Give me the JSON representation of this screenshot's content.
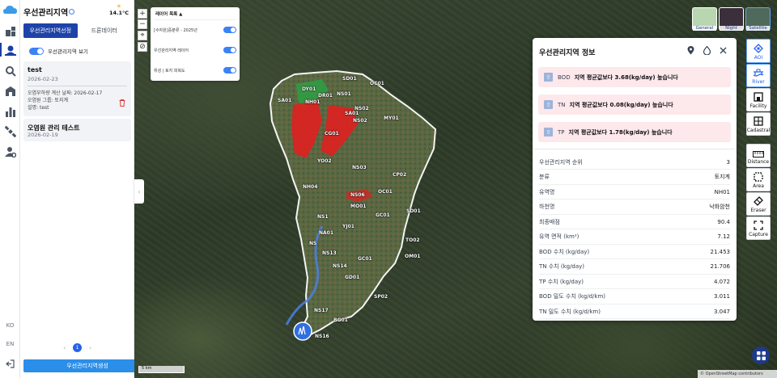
{
  "app": {
    "title": "우선관리지역",
    "weather_temp": "14.1°C"
  },
  "panel": {
    "tabs": [
      "우선관리지역선정",
      "드론데이터"
    ],
    "show_toggle_label": "우선관리지역 보기",
    "items": [
      {
        "title": "test",
        "date": "2026-02-23",
        "calc_date_label": "오염부하량 계산 날짜: 2026-02-17",
        "group_label": "오염원 그룹: 토지계",
        "desc_label": "설명: test"
      },
      {
        "title": "오염원 관리 테스트",
        "date": "2026-02-19"
      }
    ],
    "page": "1",
    "create_button": "우선관리지역생성"
  },
  "rail": {
    "icons": [
      "map-layers-icon",
      "user-location-icon",
      "analysis-icon",
      "building-icon",
      "bar-chart-icon",
      "satellite-icon",
      "user-settings-icon"
    ],
    "lang_ko": "KO",
    "lang_en": "EN"
  },
  "layers_panel": {
    "header": "레이어 목록 ▲",
    "rows": [
      {
        "label": "[수자원]중분류 - 2025년"
      },
      {
        "label": "우선관리지역 레이어"
      },
      {
        "label": "위성 | 토지 피복도"
      }
    ]
  },
  "map_labels": [
    "SD01",
    "DY01",
    "SA01",
    "NH01",
    "DR01",
    "NS01",
    "NS02",
    "SA01",
    "CG01",
    "MY01",
    "OC01",
    "YO02",
    "NS03",
    "NS02",
    "CP02",
    "NH04",
    "NS06",
    "OC01",
    "MO01",
    "GC01",
    "NS1",
    "YJ01",
    "NA01",
    "NS",
    "GC01",
    "NS13",
    "NS14",
    "GD01",
    "BG01",
    "NS17",
    "NS16",
    "SP02",
    "TO02",
    "OM01",
    "SD01"
  ],
  "basemaps": [
    {
      "label": "General",
      "color": "#b8d7b0"
    },
    {
      "label": "Night",
      "color": "#3a2f3a"
    },
    {
      "label": "Satellite",
      "color": "#4f6a5a"
    }
  ],
  "info": {
    "title": "우선관리지역 정보",
    "alerts": [
      {
        "key": "BOD",
        "message": "지역 평균값보다 3.68(kg/day) 높습니다"
      },
      {
        "key": "TN",
        "message": "지역 평균값보다 0.08(kg/day) 높습니다"
      },
      {
        "key": "TP",
        "message": "지역 평균값보다 1.78(kg/day) 높습니다"
      }
    ],
    "rows": [
      {
        "label": "우선관리지역 순위",
        "value": "3"
      },
      {
        "label": "분류",
        "value": "토지계"
      },
      {
        "label": "유역명",
        "value": "NH01"
      },
      {
        "label": "하천명",
        "value": "낙화암천"
      },
      {
        "label": "최종배점",
        "value": "90.4"
      },
      {
        "label": "유역 면적 (km²)",
        "value": "7.12"
      },
      {
        "label": "BOD 수치 (kg/day)",
        "value": "21.453"
      },
      {
        "label": "TN 수치 (kg/day)",
        "value": "21.706"
      },
      {
        "label": "TP 수치 (kg/day)",
        "value": "4.072"
      },
      {
        "label": "BOD 밀도 수치 (kg/d/km)",
        "value": "3.011"
      },
      {
        "label": "TN 밀도 수치 (kg/d/km)",
        "value": "3.047"
      }
    ]
  },
  "toolbar": {
    "aoi": "AOI",
    "river": "River",
    "facility": "Facility",
    "cadastral": "Cadastral",
    "distance": "Distance",
    "area": "Area",
    "eraser": "Eraser",
    "capture": "Capture"
  },
  "scale_label": "5 km",
  "attribution": "© OpenStreetMap contributors",
  "colors": {
    "brand": "#1e43a8",
    "accent": "#2b8ee8",
    "priority_zone": "#e02020",
    "alert_bg": "#fde8ec"
  }
}
